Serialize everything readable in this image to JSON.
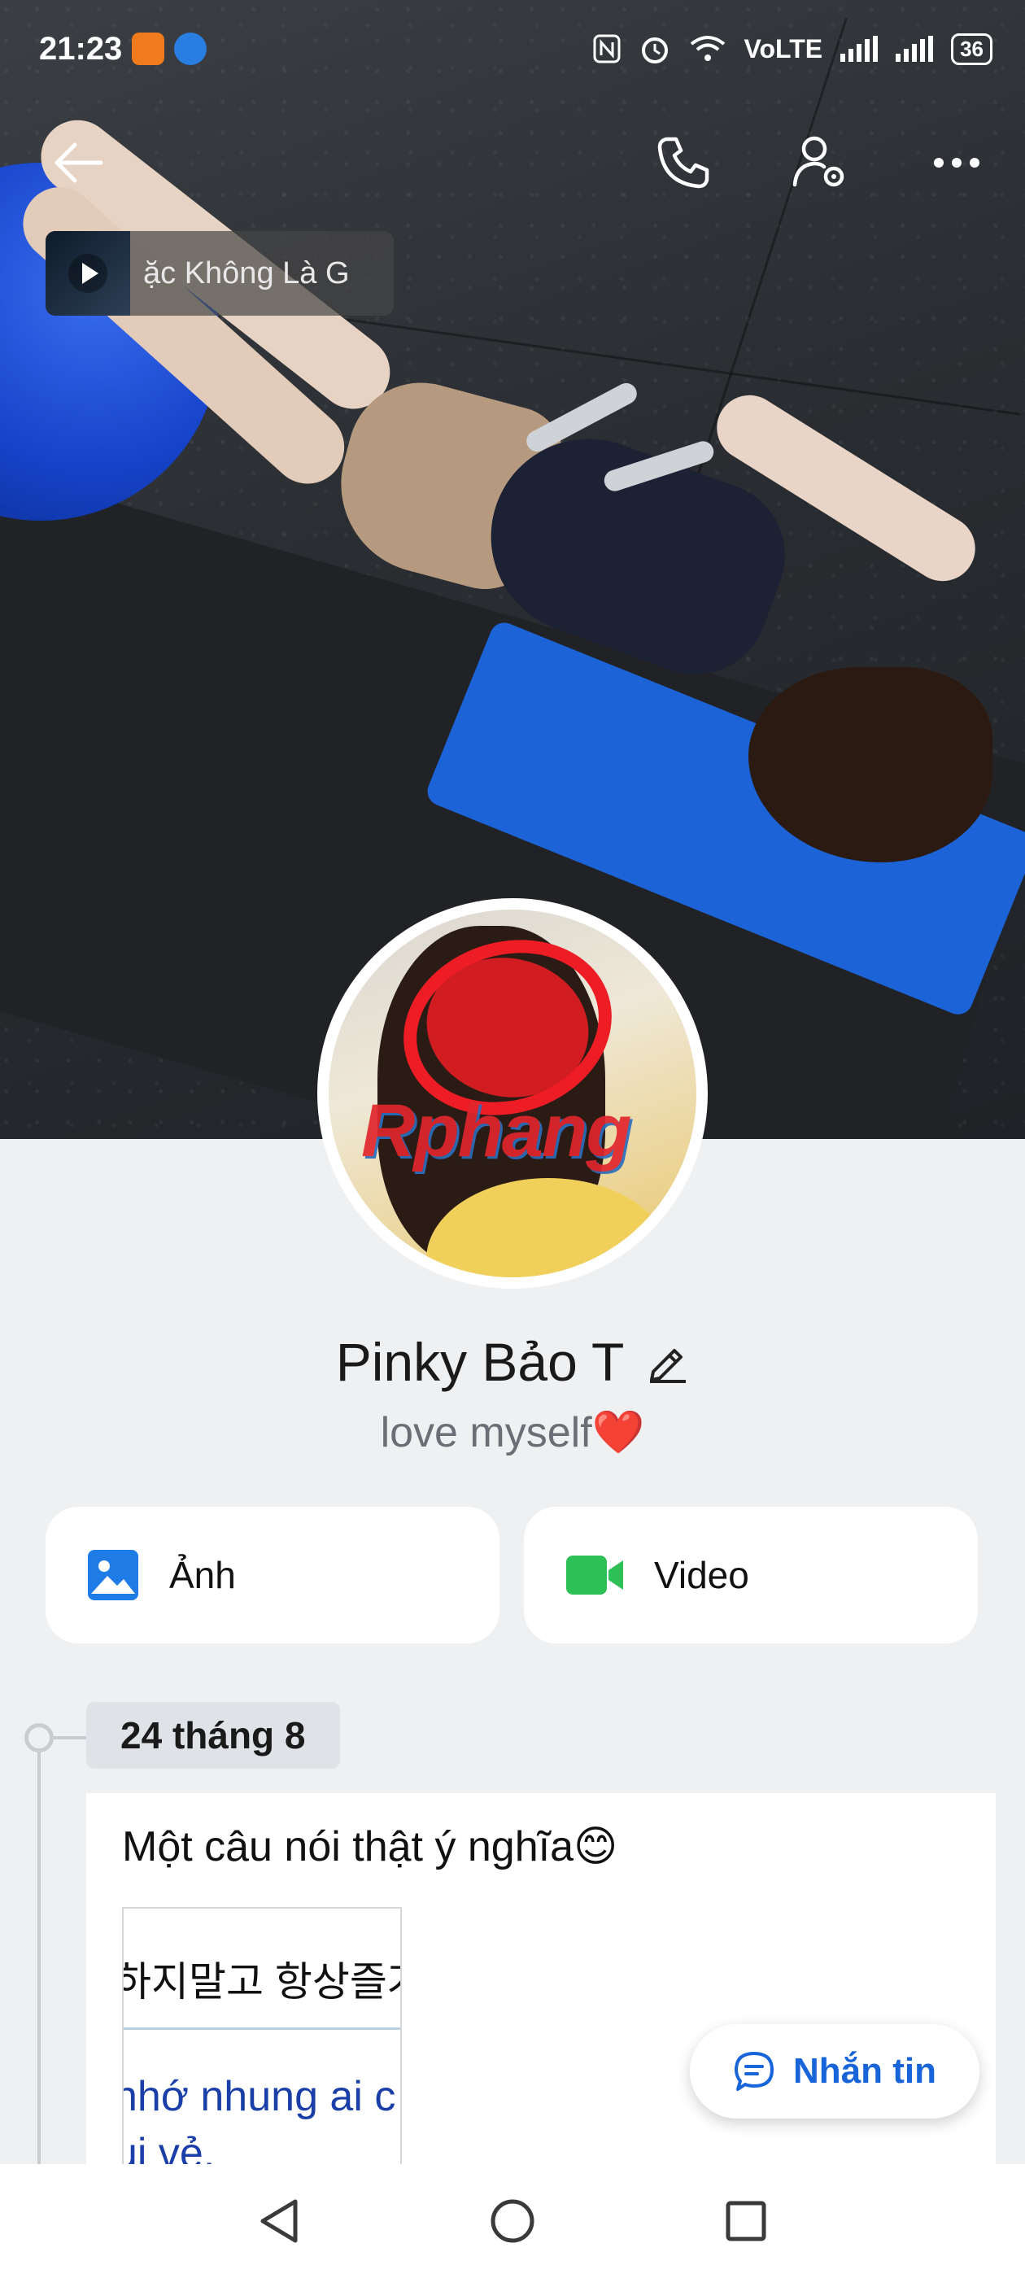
{
  "status_bar": {
    "time": "21:23",
    "network": "VoLTE",
    "battery": "36"
  },
  "music": {
    "track_title": "ặc Không Là G"
  },
  "profile": {
    "name": "Pinky Bảo T",
    "bio": "love myself❤️",
    "avatar_watermark": "Rphang"
  },
  "media_tabs": [
    {
      "label": "Ảnh",
      "icon": "photo-icon",
      "color": "#1f7ce6"
    },
    {
      "label": "Video",
      "icon": "video-camera-icon",
      "color": "#2fbf57"
    }
  ],
  "timeline": {
    "date": "24 tháng 8",
    "post": {
      "text": "Một câu nói thật ý nghĩa😊",
      "image_korean": "하지말고 항상즐거",
      "image_viet_line1": "nhớ nhung ai c",
      "image_viet_line2": "ui vẻ."
    }
  },
  "message_button": {
    "label": "Nhắn tin"
  },
  "colors": {
    "accent_blue": "#1865d9",
    "page_bg": "#eef0f2"
  }
}
